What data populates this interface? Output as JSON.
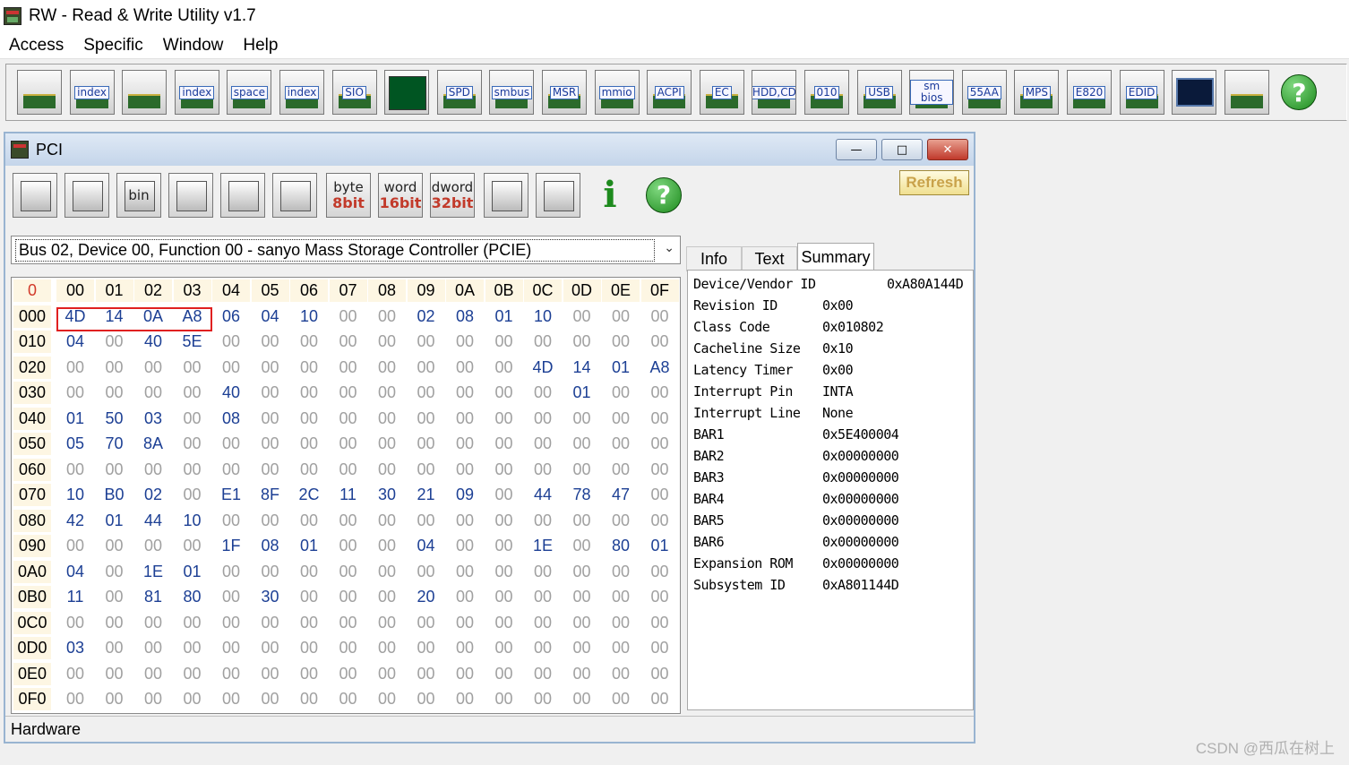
{
  "app": {
    "title": "RW - Read & Write Utility v1.7"
  },
  "menu": [
    "Access",
    "Specific",
    "Window",
    "Help"
  ],
  "toolbar": [
    {
      "name": "pci-button",
      "icon": "pci-card-icon",
      "label": ""
    },
    {
      "name": "pci-index-button",
      "icon": "pci-card-icon",
      "label": "index"
    },
    {
      "name": "memory-button",
      "icon": "memory-icon",
      "label": ""
    },
    {
      "name": "memory-index-button",
      "icon": "memory-icon",
      "label": "index"
    },
    {
      "name": "io-space-button",
      "icon": "io-icon",
      "label": "space"
    },
    {
      "name": "io-index-button",
      "icon": "io-icon",
      "label": "index"
    },
    {
      "name": "sio-button",
      "icon": "sio-icon",
      "label": "SIO"
    },
    {
      "name": "waveform-button",
      "icon": "waveform-icon",
      "label": ""
    },
    {
      "name": "spd-button",
      "icon": "spd-icon",
      "label": "SPD"
    },
    {
      "name": "smbus-button",
      "icon": "smbus-icon",
      "label": "smbus"
    },
    {
      "name": "msr-button",
      "icon": "cpu-icon",
      "label": "MSR"
    },
    {
      "name": "mmio-button",
      "icon": "mmio-icon",
      "label": "mmio"
    },
    {
      "name": "acpi-button",
      "icon": "acpi-icon",
      "label": "ACPI"
    },
    {
      "name": "ec-button",
      "icon": "ec-icon",
      "label": "EC"
    },
    {
      "name": "hdd-cd-button",
      "icon": "disk-icon",
      "label": "HDD,CD"
    },
    {
      "name": "cmos-button",
      "icon": "cmos-icon",
      "label": "010"
    },
    {
      "name": "usb-button",
      "icon": "usb-icon",
      "label": "USB"
    },
    {
      "name": "smbios-button",
      "icon": "smbios-icon",
      "label": "sm bios"
    },
    {
      "name": "55aa-button",
      "icon": "rom-icon",
      "label": "55AA"
    },
    {
      "name": "mps-button",
      "icon": "rom-icon",
      "label": "MPS"
    },
    {
      "name": "e820-button",
      "icon": "rom-icon",
      "label": "E820"
    },
    {
      "name": "edid-button",
      "icon": "rom-icon",
      "label": "EDID"
    },
    {
      "name": "command-button",
      "icon": "terminal-icon",
      "label": ""
    },
    {
      "name": "device-button",
      "icon": "device-icon",
      "label": ""
    },
    {
      "name": "help-button",
      "icon": "help-icon",
      "label": "?"
    }
  ],
  "window": {
    "title": "PCI",
    "refresh": "Refresh",
    "device": "Bus 02, Device 00, Function 00 - sanyo Mass Storage Controller (PCIE)",
    "status": "Hardware",
    "buttons": [
      {
        "name": "save-button",
        "icon": "floppy-icon",
        "top": "",
        "bot": ""
      },
      {
        "name": "save-all-button",
        "icon": "floppy-stack-icon",
        "top": "",
        "bot": ""
      },
      {
        "name": "save-bin-button",
        "icon": "floppy-bin-icon",
        "top": "bin",
        "bot": ""
      },
      {
        "name": "load-button",
        "icon": "load-icon",
        "top": "",
        "bot": ""
      },
      {
        "name": "find-button",
        "icon": "binoculars-icon",
        "top": "",
        "bot": ""
      },
      {
        "name": "compare-button",
        "icon": "table-icon",
        "top": "",
        "bot": ""
      },
      {
        "name": "byte-button",
        "icon": "",
        "top": "byte",
        "bot": "8bit"
      },
      {
        "name": "word-button",
        "icon": "",
        "top": "word",
        "bot": "16bit"
      },
      {
        "name": "dword-button",
        "icon": "",
        "top": "dword",
        "bot": "32bit"
      },
      {
        "name": "tree-button",
        "icon": "tree-icon",
        "top": "",
        "bot": ""
      },
      {
        "name": "settings-button",
        "icon": "gear-icon",
        "top": "",
        "bot": ""
      },
      {
        "name": "info-button",
        "icon": "info-icon",
        "top": "i",
        "bot": ""
      },
      {
        "name": "help2-button",
        "icon": "help-icon",
        "top": "?",
        "bot": ""
      }
    ]
  },
  "hex": {
    "corner": "0",
    "columns": [
      "00",
      "01",
      "02",
      "03",
      "04",
      "05",
      "06",
      "07",
      "08",
      "09",
      "0A",
      "0B",
      "0C",
      "0D",
      "0E",
      "0F"
    ],
    "rows": [
      {
        "addr": "000",
        "vals": [
          "4D",
          "14",
          "0A",
          "A8",
          "06",
          "04",
          "10",
          "00",
          "00",
          "02",
          "08",
          "01",
          "10",
          "00",
          "00",
          "00"
        ]
      },
      {
        "addr": "010",
        "vals": [
          "04",
          "00",
          "40",
          "5E",
          "00",
          "00",
          "00",
          "00",
          "00",
          "00",
          "00",
          "00",
          "00",
          "00",
          "00",
          "00"
        ]
      },
      {
        "addr": "020",
        "vals": [
          "00",
          "00",
          "00",
          "00",
          "00",
          "00",
          "00",
          "00",
          "00",
          "00",
          "00",
          "00",
          "4D",
          "14",
          "01",
          "A8"
        ]
      },
      {
        "addr": "030",
        "vals": [
          "00",
          "00",
          "00",
          "00",
          "40",
          "00",
          "00",
          "00",
          "00",
          "00",
          "00",
          "00",
          "00",
          "01",
          "00",
          "00"
        ]
      },
      {
        "addr": "040",
        "vals": [
          "01",
          "50",
          "03",
          "00",
          "08",
          "00",
          "00",
          "00",
          "00",
          "00",
          "00",
          "00",
          "00",
          "00",
          "00",
          "00"
        ]
      },
      {
        "addr": "050",
        "vals": [
          "05",
          "70",
          "8A",
          "00",
          "00",
          "00",
          "00",
          "00",
          "00",
          "00",
          "00",
          "00",
          "00",
          "00",
          "00",
          "00"
        ]
      },
      {
        "addr": "060",
        "vals": [
          "00",
          "00",
          "00",
          "00",
          "00",
          "00",
          "00",
          "00",
          "00",
          "00",
          "00",
          "00",
          "00",
          "00",
          "00",
          "00"
        ]
      },
      {
        "addr": "070",
        "vals": [
          "10",
          "B0",
          "02",
          "00",
          "E1",
          "8F",
          "2C",
          "11",
          "30",
          "21",
          "09",
          "00",
          "44",
          "78",
          "47",
          "00"
        ]
      },
      {
        "addr": "080",
        "vals": [
          "42",
          "01",
          "44",
          "10",
          "00",
          "00",
          "00",
          "00",
          "00",
          "00",
          "00",
          "00",
          "00",
          "00",
          "00",
          "00"
        ]
      },
      {
        "addr": "090",
        "vals": [
          "00",
          "00",
          "00",
          "00",
          "1F",
          "08",
          "01",
          "00",
          "00",
          "04",
          "00",
          "00",
          "1E",
          "00",
          "80",
          "01"
        ]
      },
      {
        "addr": "0A0",
        "vals": [
          "04",
          "00",
          "1E",
          "01",
          "00",
          "00",
          "00",
          "00",
          "00",
          "00",
          "00",
          "00",
          "00",
          "00",
          "00",
          "00"
        ]
      },
      {
        "addr": "0B0",
        "vals": [
          "11",
          "00",
          "81",
          "80",
          "00",
          "30",
          "00",
          "00",
          "00",
          "20",
          "00",
          "00",
          "00",
          "00",
          "00",
          "00"
        ]
      },
      {
        "addr": "0C0",
        "vals": [
          "00",
          "00",
          "00",
          "00",
          "00",
          "00",
          "00",
          "00",
          "00",
          "00",
          "00",
          "00",
          "00",
          "00",
          "00",
          "00"
        ]
      },
      {
        "addr": "0D0",
        "vals": [
          "03",
          "00",
          "00",
          "00",
          "00",
          "00",
          "00",
          "00",
          "00",
          "00",
          "00",
          "00",
          "00",
          "00",
          "00",
          "00"
        ]
      },
      {
        "addr": "0E0",
        "vals": [
          "00",
          "00",
          "00",
          "00",
          "00",
          "00",
          "00",
          "00",
          "00",
          "00",
          "00",
          "00",
          "00",
          "00",
          "00",
          "00"
        ]
      },
      {
        "addr": "0F0",
        "vals": [
          "00",
          "00",
          "00",
          "00",
          "00",
          "00",
          "00",
          "00",
          "00",
          "00",
          "00",
          "00",
          "00",
          "00",
          "00",
          "00"
        ]
      }
    ],
    "highlight_color": "#e02020",
    "nonzero_color": "#1c3f94",
    "zero_color": "#a0a0a0"
  },
  "tabs": [
    {
      "label": "Info",
      "active": false
    },
    {
      "label": "Text",
      "active": false
    },
    {
      "label": "Summary",
      "active": true
    }
  ],
  "summary": [
    {
      "label": "Device/Vendor ID",
      "value": "0xA80A144D"
    },
    {
      "label": "Revision ID",
      "value": "0x00"
    },
    {
      "label": "Class Code",
      "value": "0x010802"
    },
    {
      "label": "Cacheline Size",
      "value": "0x10"
    },
    {
      "label": "Latency Timer",
      "value": "0x00"
    },
    {
      "label": "Interrupt Pin",
      "value": "INTA"
    },
    {
      "label": "Interrupt Line",
      "value": "None"
    },
    {
      "label": "BAR1",
      "value": "0x5E400004"
    },
    {
      "label": "BAR2",
      "value": "0x00000000"
    },
    {
      "label": "BAR3",
      "value": "0x00000000"
    },
    {
      "label": "BAR4",
      "value": "0x00000000"
    },
    {
      "label": "BAR5",
      "value": "0x00000000"
    },
    {
      "label": "BAR6",
      "value": "0x00000000"
    },
    {
      "label": "Expansion ROM",
      "value": "0x00000000"
    },
    {
      "label": "Subsystem ID",
      "value": "0xA801144D"
    }
  ],
  "watermark": "CSDN @西瓜在树上"
}
